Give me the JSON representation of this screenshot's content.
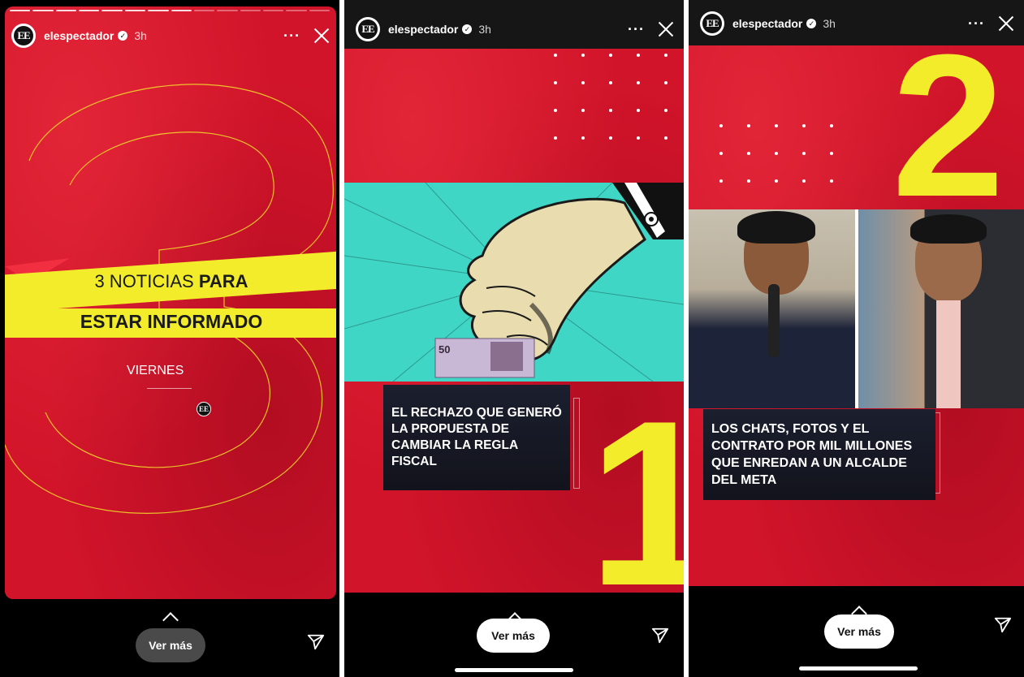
{
  "account": {
    "username": "elespectador",
    "time": "3h",
    "avatar_text": "EE"
  },
  "stories": [
    {
      "title_line1_normal": "3 NOTICIAS ",
      "title_line1_bold": "PARA",
      "title_line2": "ESTAR INFORMADO",
      "day": "VIERNES",
      "logo_text": "EE",
      "ver_mas": "Ver más"
    },
    {
      "headline": "EL RECHAZO QUE GENERÓ LA PROPUESTA DE CAMBIAR LA REGLA FISCAL",
      "number": "1",
      "banknote_value": "50",
      "ver_mas": "Ver más"
    },
    {
      "headline": "LOS CHATS, FOTOS Y EL CONTRATO POR MIL MILLONES QUE ENREDAN A UN ALCALDE DEL META",
      "number": "2",
      "ver_mas": "Ver más"
    }
  ],
  "icons": {
    "more": "more-icon",
    "close": "close-icon",
    "send": "send-icon",
    "caret": "chevron-up-icon",
    "verified": "verified-icon"
  },
  "colors": {
    "story_red": "#d2142a",
    "accent_yellow": "#f2ec2a",
    "teal": "#3fd6c5",
    "headline_bg": "#1b1f2e"
  }
}
